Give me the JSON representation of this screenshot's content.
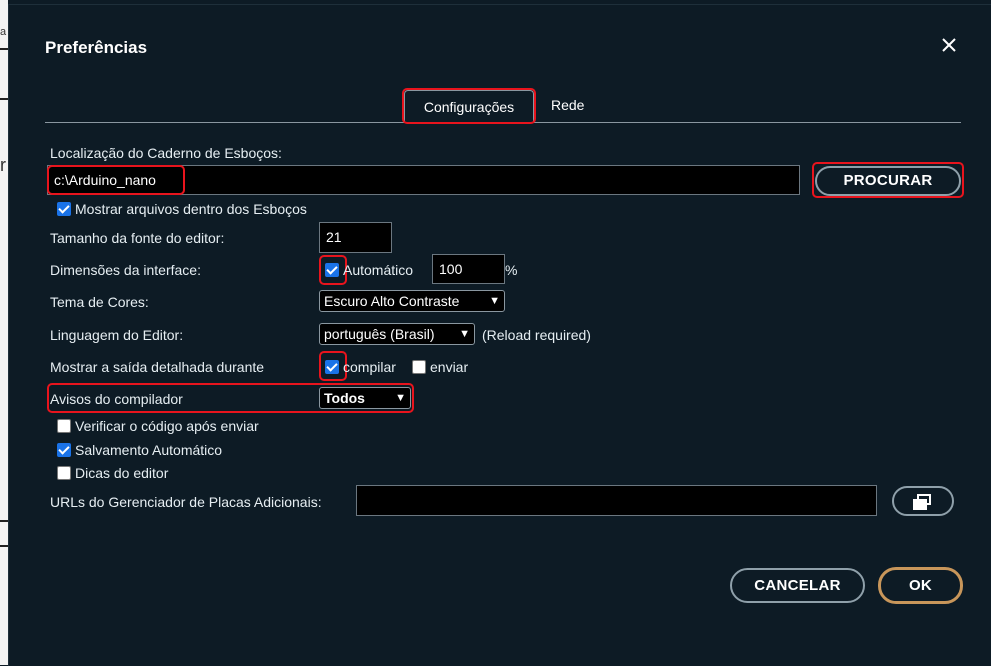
{
  "dialog": {
    "title": "Preferências",
    "close_icon": "close-icon"
  },
  "tabs": [
    {
      "label": "Configurações",
      "active": true
    },
    {
      "label": "Rede",
      "active": false
    }
  ],
  "sketchbook": {
    "label": "Localização do Caderno de Esboços:",
    "value": "c:\\Arduino_nano",
    "browse_label": "PROCURAR"
  },
  "show_files": {
    "label": "Mostrar arquivos dentro dos Esboços",
    "checked": true
  },
  "font_size": {
    "label": "Tamanho da fonte do editor:",
    "value": "21"
  },
  "interface_scale": {
    "label": "Dimensões da interface:",
    "auto_label": "Automático",
    "auto_checked": true,
    "value": "100",
    "unit": "%"
  },
  "theme": {
    "label": "Tema de Cores:",
    "selected": "Escuro Alto Contraste"
  },
  "language": {
    "label": "Linguagem do Editor:",
    "selected": "português (Brasil)",
    "note": "(Reload required)"
  },
  "verbose": {
    "label": "Mostrar a saída detalhada durante",
    "compile_label": "compilar",
    "compile_checked": true,
    "upload_label": "enviar",
    "upload_checked": false
  },
  "warnings": {
    "label": "Avisos do compilador",
    "selected": "Todos"
  },
  "verify_after_upload": {
    "label": "Verificar o código após enviar",
    "checked": false
  },
  "auto_save": {
    "label": "Salvamento Automático",
    "checked": true
  },
  "editor_hints": {
    "label": "Dicas do editor",
    "checked": false
  },
  "board_urls": {
    "label": "URLs do Gerenciador de Placas Adicionais:",
    "value": "",
    "button_icon": "open-window-icon"
  },
  "footer": {
    "cancel_label": "CANCELAR",
    "ok_label": "OK"
  },
  "background": {
    "edge_chars": [
      "a",
      "r"
    ]
  },
  "colors": {
    "accent_checkbox": "#1a73e8",
    "highlight": "#e8141d",
    "ok_border": "#c8965a",
    "background": "#0d1b25"
  }
}
